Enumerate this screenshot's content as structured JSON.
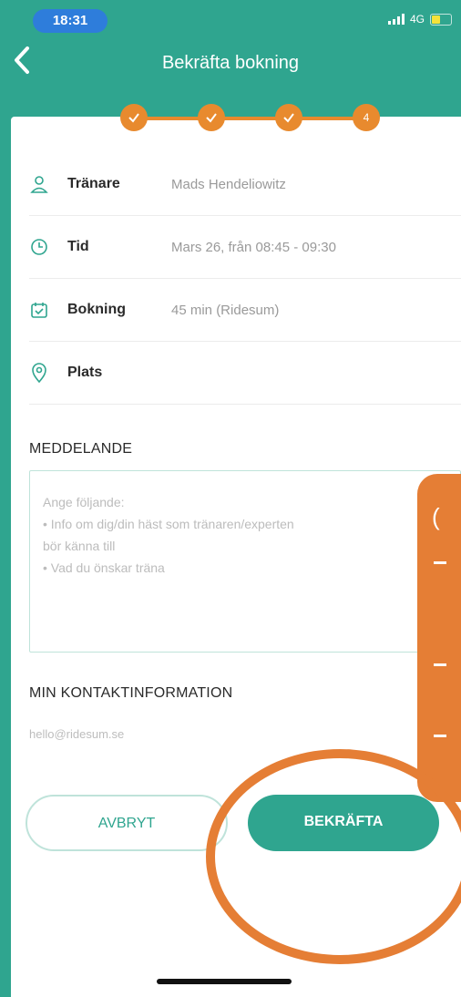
{
  "status_bar": {
    "time": "18:31",
    "network": "4G"
  },
  "header": {
    "title": "Bekräfta bokning"
  },
  "stepper": {
    "current_step": "4"
  },
  "booking": {
    "rows": [
      {
        "label": "Tränare",
        "value": "Mads Hendeliowitz",
        "icon": "person-icon"
      },
      {
        "label": "Tid",
        "value": "Mars 26, från 08:45 - 09:30",
        "icon": "clock-icon"
      },
      {
        "label": "Bokning",
        "value": "45 min (Ridesum)",
        "icon": "calendar-check-icon"
      },
      {
        "label": "Plats",
        "value": "",
        "icon": "location-pin-icon"
      }
    ]
  },
  "message": {
    "title": "MEDDELANDE",
    "placeholder_intro": "Ange följande:",
    "placeholder_item1": "•  Info om dig/din häst som tränaren/experten",
    "placeholder_item1_cont": "bör känna till",
    "placeholder_item2": "•  Vad du önskar träna"
  },
  "contact": {
    "title": "MIN KONTAKTINFORMATION",
    "email": "hello@ridesum.se"
  },
  "actions": {
    "cancel_label": "AVBRYT",
    "confirm_label": "BEKRÄFTA"
  },
  "annotation": {
    "callout_char": "("
  },
  "colors": {
    "primary": "#2fa58f",
    "accent": "#e88a2e",
    "annotation": "#e57e35"
  }
}
